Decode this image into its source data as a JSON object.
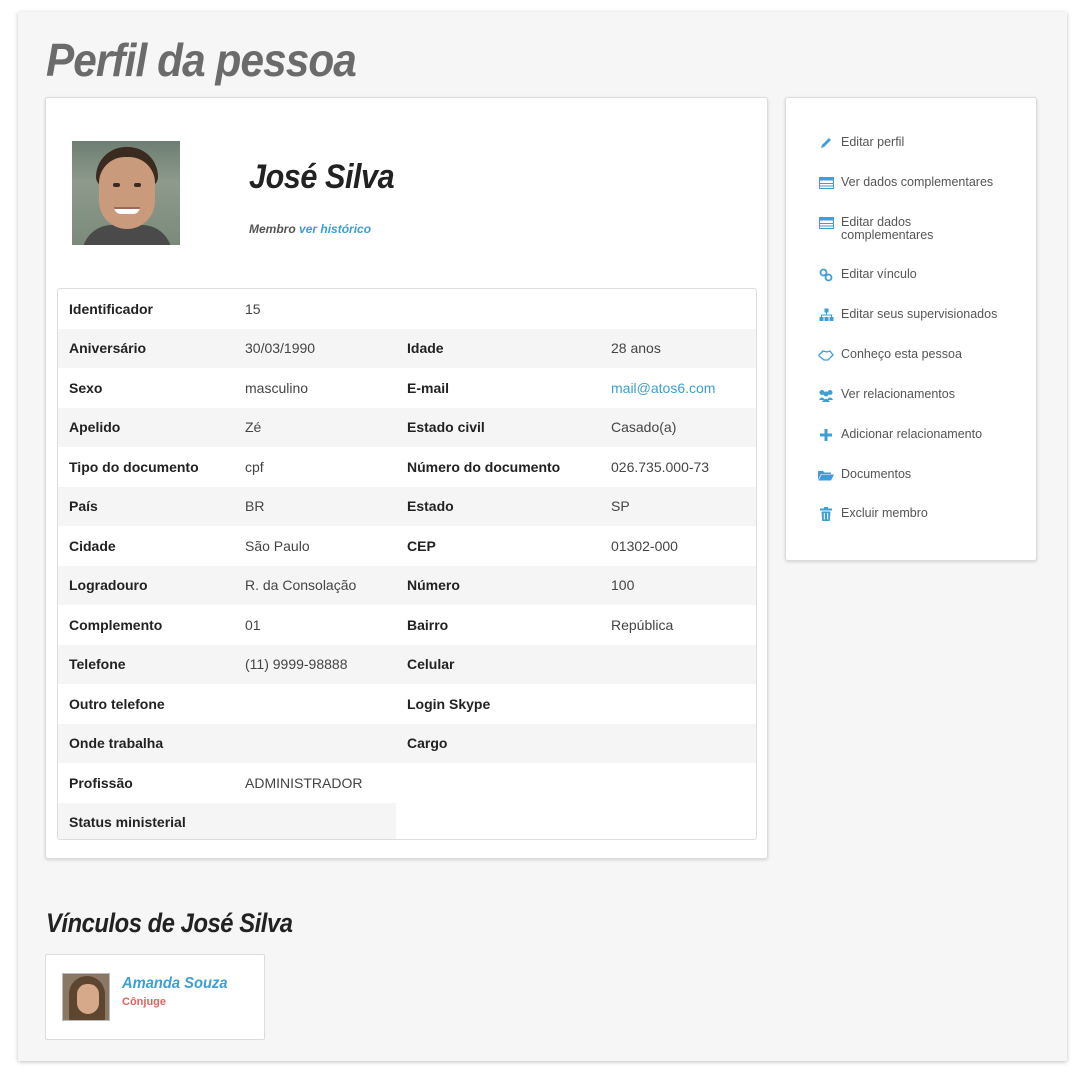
{
  "page": {
    "title": "Perfil da pessoa"
  },
  "profile": {
    "name": "José Silva",
    "role": "Membro",
    "history_link": "ver histórico"
  },
  "table": {
    "rows": [
      {
        "l1": "Identificador",
        "v1": "15",
        "l2": "",
        "v2": ""
      },
      {
        "l1": "Aniversário",
        "v1": "30/03/1990",
        "l2": "Idade",
        "v2": "28 anos"
      },
      {
        "l1": "Sexo",
        "v1": "masculino",
        "l2": "E-mail",
        "v2": "mail@atos6.com"
      },
      {
        "l1": "Apelido",
        "v1": "Zé",
        "l2": "Estado civil",
        "v2": "Casado(a)"
      },
      {
        "l1": "Tipo do documento",
        "v1": "cpf",
        "l2": "Número do documento",
        "v2": "026.735.000-73"
      },
      {
        "l1": "País",
        "v1": "BR",
        "l2": "Estado",
        "v2": "SP"
      },
      {
        "l1": "Cidade",
        "v1": "São Paulo",
        "l2": "CEP",
        "v2": "01302-000"
      },
      {
        "l1": "Logradouro",
        "v1": "R. da Consolação",
        "l2": "Número",
        "v2": "100"
      },
      {
        "l1": "Complemento",
        "v1": "01",
        "l2": "Bairro",
        "v2": "República"
      },
      {
        "l1": "Telefone",
        "v1": "(11) 9999-98888",
        "l2": "Celular",
        "v2": ""
      },
      {
        "l1": "Outro telefone",
        "v1": "",
        "l2": "Login Skype",
        "v2": ""
      },
      {
        "l1": "Onde trabalha",
        "v1": "",
        "l2": "Cargo",
        "v2": ""
      },
      {
        "l1": "Profissão",
        "v1": "ADMINISTRADOR",
        "l2": "",
        "v2": ""
      },
      {
        "l1": "Status ministerial",
        "v1": "",
        "l2": "",
        "v2": ""
      }
    ]
  },
  "actions": [
    {
      "label": "Editar perfil",
      "icon": "pencil-icon"
    },
    {
      "label": "Ver dados complementares",
      "icon": "table-icon"
    },
    {
      "label": "Editar dados complementares",
      "icon": "table-icon"
    },
    {
      "label": "Editar vínculo",
      "icon": "link-icon"
    },
    {
      "label": "Editar seus supervisionados",
      "icon": "sitemap-icon"
    },
    {
      "label": "Conheço esta pessoa",
      "icon": "handshake-icon"
    },
    {
      "label": "Ver relacionamentos",
      "icon": "users-icon"
    },
    {
      "label": "Adicionar relacionamento",
      "icon": "plus-icon"
    },
    {
      "label": "Documentos",
      "icon": "folder-icon"
    },
    {
      "label": "Excluir membro",
      "icon": "trash-icon"
    }
  ],
  "links": {
    "title": "Vínculos de José Silva",
    "items": [
      {
        "name": "Amanda Souza",
        "relation": "Cônjuge"
      }
    ]
  },
  "colors": {
    "accent": "#3d9fd3",
    "relation": "#e0635e",
    "background": "#f6f6f6"
  }
}
